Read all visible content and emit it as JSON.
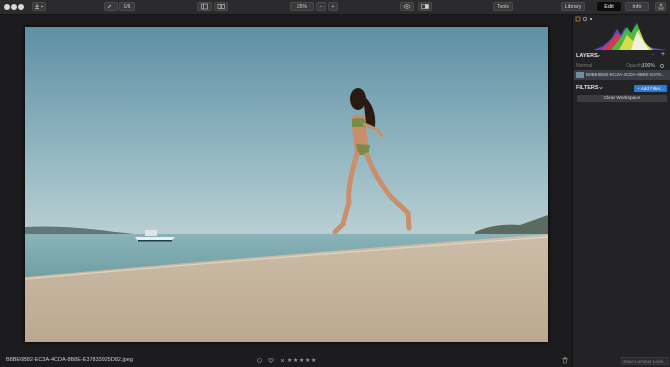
{
  "toolbar": {
    "zoom_value": "25%",
    "zoom_out_label": "−",
    "zoom_in_label": "+",
    "tools_label": "Tools",
    "tabs": [
      {
        "label": "Library"
      },
      {
        "label": "Edit"
      },
      {
        "label": "Info"
      }
    ],
    "active_tab": "Edit",
    "view_label": "1/6"
  },
  "panel": {
    "layers_title": "LAYERS",
    "add_layer_label": "+",
    "blend_mode": "Normal",
    "opacity_label": "Opacity:",
    "opacity_value": "100%",
    "layer_name": "B8BE6B82-EC3A-4CDA-8B8E-E378...",
    "filters_title": "FILTERS",
    "add_filter_label": "+ Add Filter...",
    "clear_workspace_label": "Clear Workspace",
    "save_look_label": "Save Luminar Look..."
  },
  "bottombar": {
    "filename": "B8BE6B82-EC3A-4CDA-8B8E-E37833925D82.jpeg",
    "rating_stars": 5
  },
  "colors": {
    "accent": "#2d7ad6",
    "active_tab_bg": "#0c0c0c"
  }
}
